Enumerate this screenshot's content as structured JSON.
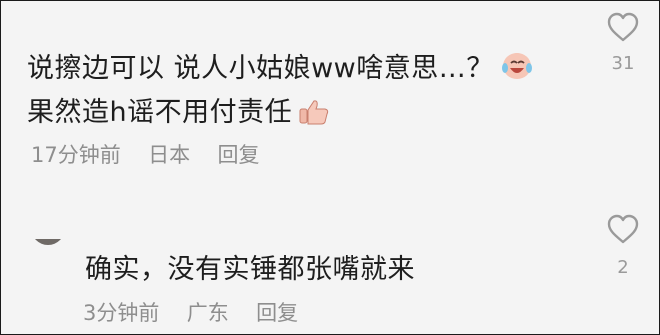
{
  "comments": [
    {
      "line1": "说擦边可以 说人小姑娘ww啥意思…？",
      "line1_emoji": "laughing-crying-emoji",
      "line2": "果然造h谣不用付责任",
      "line2_emoji": "thumbs-up-emoji",
      "time": "17分钟前",
      "location": "日本",
      "reply_label": "回复",
      "like_count": "31"
    },
    {
      "text": "确实，没有实锤都张嘴就来",
      "time": "3分钟前",
      "location": "广东",
      "reply_label": "回复",
      "like_count": "2"
    }
  ],
  "colors": {
    "background": "#f4f4f4",
    "text": "#1e1e1e",
    "meta": "#8e8e8e",
    "icon": "#9a9a9a"
  }
}
